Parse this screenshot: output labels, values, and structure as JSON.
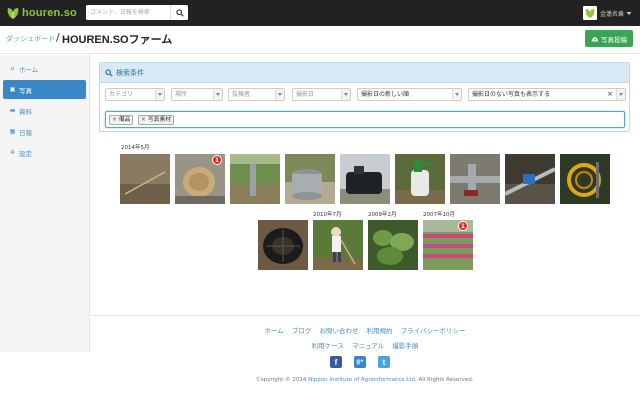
{
  "navbar": {
    "logo_text": "houren.so",
    "search_placeholder": "コメント、日報を検索",
    "user_name": "金蓮名乗"
  },
  "header": {
    "breadcrumb_link": "ダッシュボード",
    "separator": "/",
    "title": "HOUREN.SOファーム",
    "post_photo_label": "写真投稿"
  },
  "sidebar": {
    "items": [
      {
        "label": "ホーム",
        "icon": "home-icon"
      },
      {
        "label": "写真",
        "icon": "picture-icon"
      },
      {
        "label": "資料",
        "icon": "folder-icon"
      },
      {
        "label": "日報",
        "icon": "calendar-icon"
      },
      {
        "label": "設定",
        "icon": "gear-icon"
      }
    ]
  },
  "search_panel": {
    "title": "検索条件",
    "filters": {
      "category": "カテゴリ",
      "place": "場所",
      "poster": "投稿者",
      "date": "撮影日",
      "order": "撮影日の新しい順",
      "no_date": "撮影日のない写真も表示する"
    },
    "tags": [
      "備品",
      "写真素材"
    ]
  },
  "gallery": {
    "date_labels": [
      "2014年5月",
      "2010年7月",
      "2009年2月",
      "2007年10月"
    ],
    "badges": [
      "1",
      "1"
    ]
  },
  "footer": {
    "links_row1": [
      "ホーム",
      "ブログ",
      "お問い合わせ",
      "利用規約",
      "プライバシーポリシー"
    ],
    "links_row2": [
      "利用ケース",
      "マニュアル",
      "撮影手順"
    ],
    "social": [
      "f",
      "g+",
      "t"
    ],
    "copyright_prefix": "Copyright © 2014",
    "copyright_org": "Nippon Institute of Agroinformatics Ltd.",
    "copyright_suffix": "All Rights Reserved."
  },
  "colors": {
    "navbar": "#222222",
    "accent_green": "#3aa655",
    "active_blue": "#3a87c8",
    "badge_red": "#e8262d"
  }
}
